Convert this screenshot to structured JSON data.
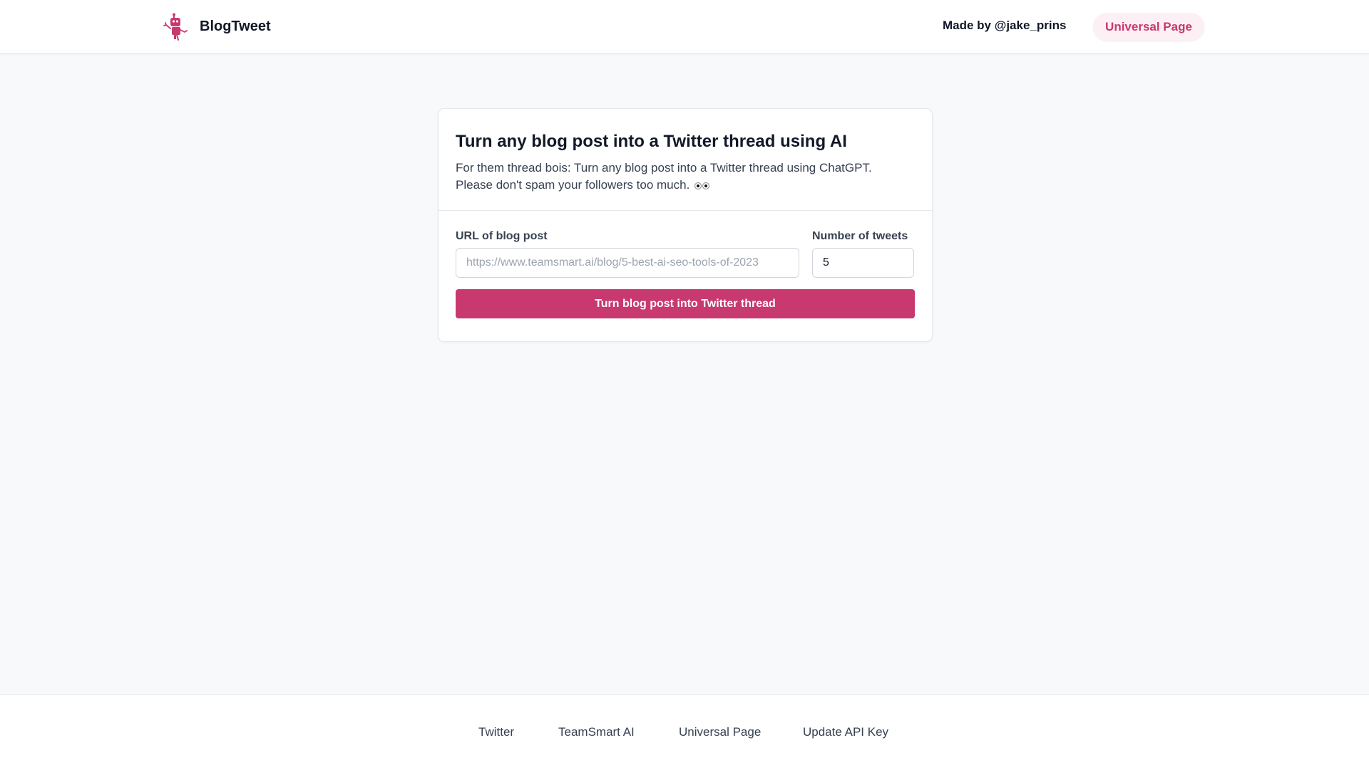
{
  "brand": {
    "name": "BlogTweet",
    "logo_icon": "robot-icon",
    "accent": "#c8396f"
  },
  "header": {
    "made_by": "Made by @jake_prins",
    "universal_page_label": "Universal Page"
  },
  "card": {
    "title": "Turn any blog post into a Twitter thread using AI",
    "description": "For them thread bois: Turn any blog post into a Twitter thread using ChatGPT. Please don't spam your followers too much.",
    "description_emoji": "eyes-emoji"
  },
  "form": {
    "url_label": "URL of blog post",
    "url_placeholder": "https://www.teamsmart.ai/blog/5-best-ai-seo-tools-of-2023",
    "url_value": "",
    "tweets_label": "Number of tweets",
    "tweets_value": "5",
    "submit_label": "Turn blog post into Twitter thread"
  },
  "footer": {
    "links": [
      "Twitter",
      "TeamSmart AI",
      "Universal Page",
      "Update API Key"
    ]
  }
}
